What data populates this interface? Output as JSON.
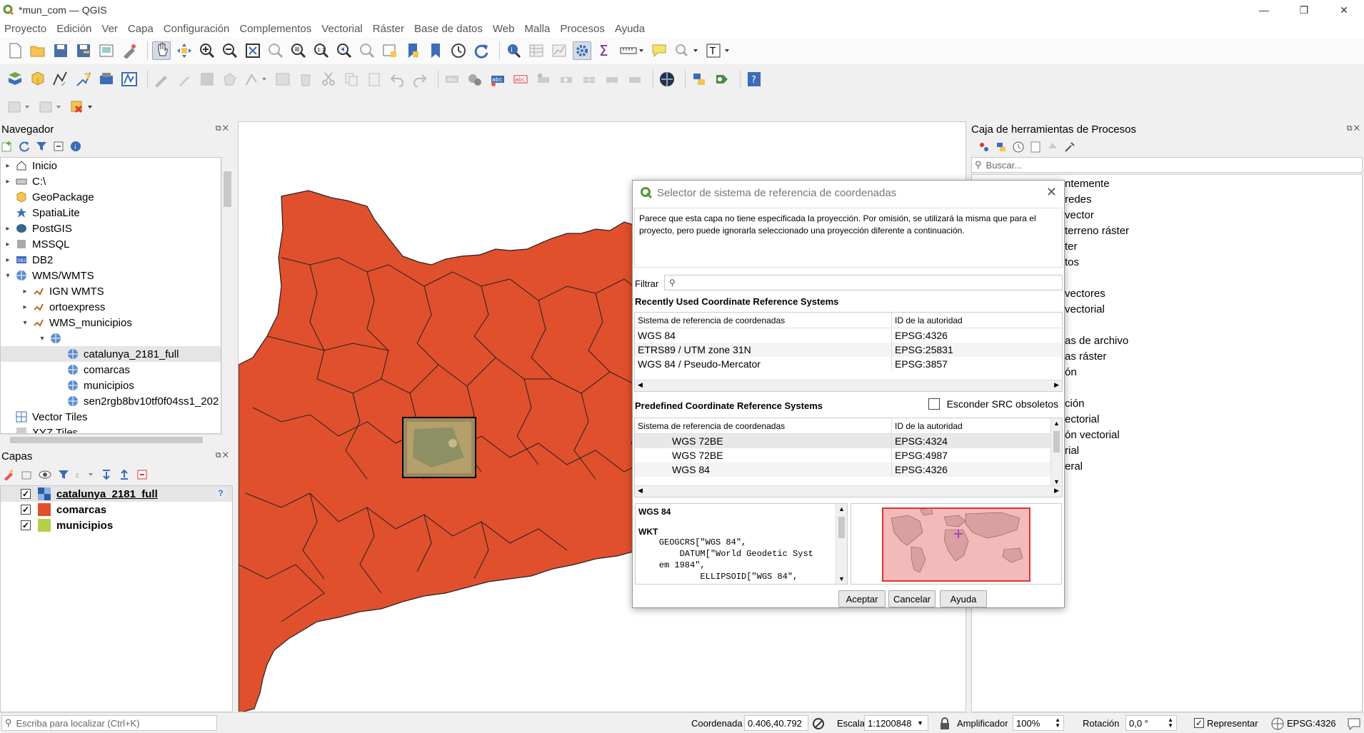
{
  "window": {
    "title": "*mun_com — QGIS",
    "controls": [
      "—",
      "❐",
      "✕"
    ]
  },
  "menu": [
    "Proyecto",
    "Edición",
    "Ver",
    "Capa",
    "Configuración",
    "Complementos",
    "Vectorial",
    "Ráster",
    "Base de datos",
    "Web",
    "Malla",
    "Procesos",
    "Ayuda"
  ],
  "navigator": {
    "title": "Navegador",
    "items": [
      {
        "label": "Inicio",
        "level": 0,
        "arrow": "▸",
        "icon": "home-icon"
      },
      {
        "label": "C:\\",
        "level": 0,
        "arrow": "▸",
        "icon": "drive-icon"
      },
      {
        "label": "GeoPackage",
        "level": 0,
        "arrow": "",
        "icon": "geopackage-icon"
      },
      {
        "label": "SpatiaLite",
        "level": 0,
        "arrow": "",
        "icon": "spatialite-icon"
      },
      {
        "label": "PostGIS",
        "level": 0,
        "arrow": "▸",
        "icon": "postgis-icon"
      },
      {
        "label": "MSSQL",
        "level": 0,
        "arrow": "▸",
        "icon": "mssql-icon"
      },
      {
        "label": "DB2",
        "level": 0,
        "arrow": "▸",
        "icon": "db2-icon"
      },
      {
        "label": "WMS/WMTS",
        "level": 0,
        "arrow": "▾",
        "icon": "globe-icon"
      },
      {
        "label": "IGN WMTS",
        "level": 1,
        "arrow": "▸",
        "icon": "wms-connection-icon"
      },
      {
        "label": "ortoexpress",
        "level": 1,
        "arrow": "▸",
        "icon": "wms-connection-icon"
      },
      {
        "label": "WMS_municipios",
        "level": 1,
        "arrow": "▾",
        "icon": "wms-connection-icon"
      },
      {
        "label": "",
        "level": 2,
        "arrow": "▾",
        "icon": "globe-icon"
      },
      {
        "label": "catalunya_2181_full",
        "level": 3,
        "arrow": "",
        "icon": "globe-icon",
        "selected": true
      },
      {
        "label": "comarcas",
        "level": 3,
        "arrow": "",
        "icon": "globe-icon"
      },
      {
        "label": "municipios",
        "level": 3,
        "arrow": "",
        "icon": "globe-icon"
      },
      {
        "label": "sen2rgb8bv10tf0f04ss1_202",
        "level": 3,
        "arrow": "",
        "icon": "globe-icon"
      },
      {
        "label": "Vector Tiles",
        "level": 0,
        "arrow": "",
        "icon": "vector-tiles-icon"
      },
      {
        "label": "XYZ Tiles",
        "level": 0,
        "arrow": "",
        "icon": "xyz-tiles-icon"
      }
    ]
  },
  "layers": {
    "title": "Capas",
    "items": [
      {
        "label": "catalunya_2181_full",
        "checked": "✓",
        "color": "#2a5fa8",
        "selected": true,
        "badge": "?"
      },
      {
        "label": "comarcas",
        "checked": "✓",
        "color": "#e0502c"
      },
      {
        "label": "municipios",
        "checked": "✓",
        "color": "#b5cf48"
      }
    ]
  },
  "map": {
    "fill_color": "#e0502c"
  },
  "toolbox": {
    "title": "Caja de herramientas de Procesos",
    "search_placeholder": "Buscar...",
    "items": [
      "ntemente",
      "redes",
      "vector",
      "terreno ráster",
      "ter",
      "tos",
      "",
      "vectores",
      "vectorial",
      "",
      "as de archivo",
      "as ráster",
      "ón",
      "",
      "ción",
      "ectorial",
      "ón vectorial",
      "rial",
      "eral"
    ]
  },
  "dialog": {
    "title": "Selector de sistema de referencia de coordenadas",
    "message": "Parece que esta capa no tiene especificada la proyección. Por omisión, se utilizará la misma que para el proyecto, pero puede ignorarla seleccionado una proyección diferente a continuación.",
    "filter_label": "Filtrar",
    "recent_title": "Recently Used Coordinate Reference Systems",
    "col_crs": "Sistema de referencia de coordenadas",
    "col_id": "ID de la autoridad",
    "recent": [
      {
        "name": "WGS 84",
        "id": "EPSG:4326"
      },
      {
        "name": "ETRS89 / UTM zone 31N",
        "id": "EPSG:25831"
      },
      {
        "name": "WGS 84 / Pseudo-Mercator",
        "id": "EPSG:3857"
      }
    ],
    "predefined_title": "Predefined Coordinate Reference Systems",
    "hide_deprecated": "Esconder SRC obsoletos",
    "predefined": [
      {
        "name": "WGS 72BE",
        "id": "EPSG:4324"
      },
      {
        "name": "WGS 72BE",
        "id": "EPSG:4987"
      },
      {
        "name": "WGS 84",
        "id": "EPSG:4326"
      }
    ],
    "wkt_name": "WGS 84",
    "wkt_label": "WKT",
    "wkt_text": "    GEOGCRS[\"WGS 84\",\n        DATUM[\"World Geodetic Syst\n    em 1984\",\n            ELLIPSOID[\"WGS 84\",",
    "buttons": {
      "ok": "Aceptar",
      "cancel": "Cancelar",
      "help": "Ayuda"
    }
  },
  "statusbar": {
    "locate_placeholder": "Escriba para localizar (Ctrl+K)",
    "coord_label": "Coordenada",
    "coord_value": "0.406,40.792",
    "scale_label": "Escala",
    "scale_value": "1:1200848",
    "magnifier_label": "Amplificador",
    "magnifier_value": "100%",
    "rotation_label": "Rotación",
    "rotation_value": "0,0 °",
    "render_label": "Representar",
    "crs": "EPSG:4326"
  }
}
